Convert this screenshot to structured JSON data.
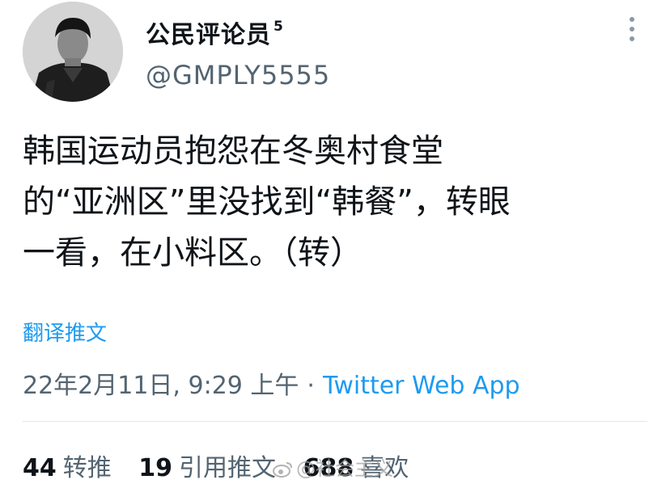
{
  "author": {
    "display_name": "公民评论员",
    "name_superscript": "5",
    "handle": "@GMPLY5555",
    "avatar_icon": "profile-photo-man"
  },
  "tweet": {
    "lines": [
      "韩国运动员抱怨在冬奥村食堂",
      "的“亚洲区”里没找到“韩餐”，转眼",
      "一看，在小料区。（转）"
    ]
  },
  "translate_label": "翻译推文",
  "meta": {
    "timestamp": "22年2月11日, 9:29 上午",
    "separator": "·",
    "source": "Twitter Web App"
  },
  "stats": {
    "retweets": {
      "count": "44",
      "label": "转推"
    },
    "quotes": {
      "count": "19",
      "label": "引用推文"
    },
    "likes": {
      "count": "688",
      "label": "喜欢"
    }
  },
  "watermark": {
    "text": "@社会主义"
  },
  "colors": {
    "accent": "#1d9bf0",
    "secondary_text": "#536471",
    "primary_text": "#0f1419"
  }
}
